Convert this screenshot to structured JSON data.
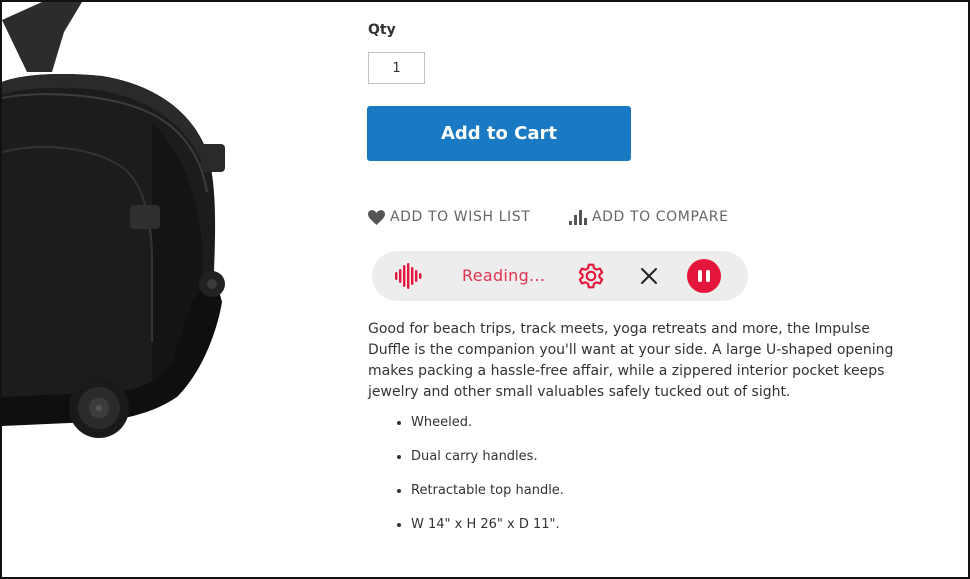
{
  "qty": {
    "label": "Qty",
    "value": "1"
  },
  "actions": {
    "add_to_cart": "Add to Cart",
    "wishlist": "ADD TO WISH LIST",
    "compare": "ADD TO COMPARE"
  },
  "reader": {
    "status": "Reading...",
    "icons": [
      "soundwave-icon",
      "gear-icon",
      "close-icon",
      "pause-icon"
    ],
    "accent_color": "#e6153b"
  },
  "description": {
    "text": "Good for beach trips, track meets, yoga retreats and more, the Impulse Duffle is the companion you'll want at your side. A large U-shaped opening makes packing a hassle-free affair, while a zippered interior pocket keeps jewelry and other small valuables safely tucked out of sight.",
    "features": [
      "Wheeled.",
      "Dual carry handles.",
      "Retractable top handle.",
      "W 14\" x H 26\" x D 11\"."
    ]
  },
  "colors": {
    "primary_button": "#1979c3",
    "link_text": "#666666",
    "body_text": "#333333"
  }
}
